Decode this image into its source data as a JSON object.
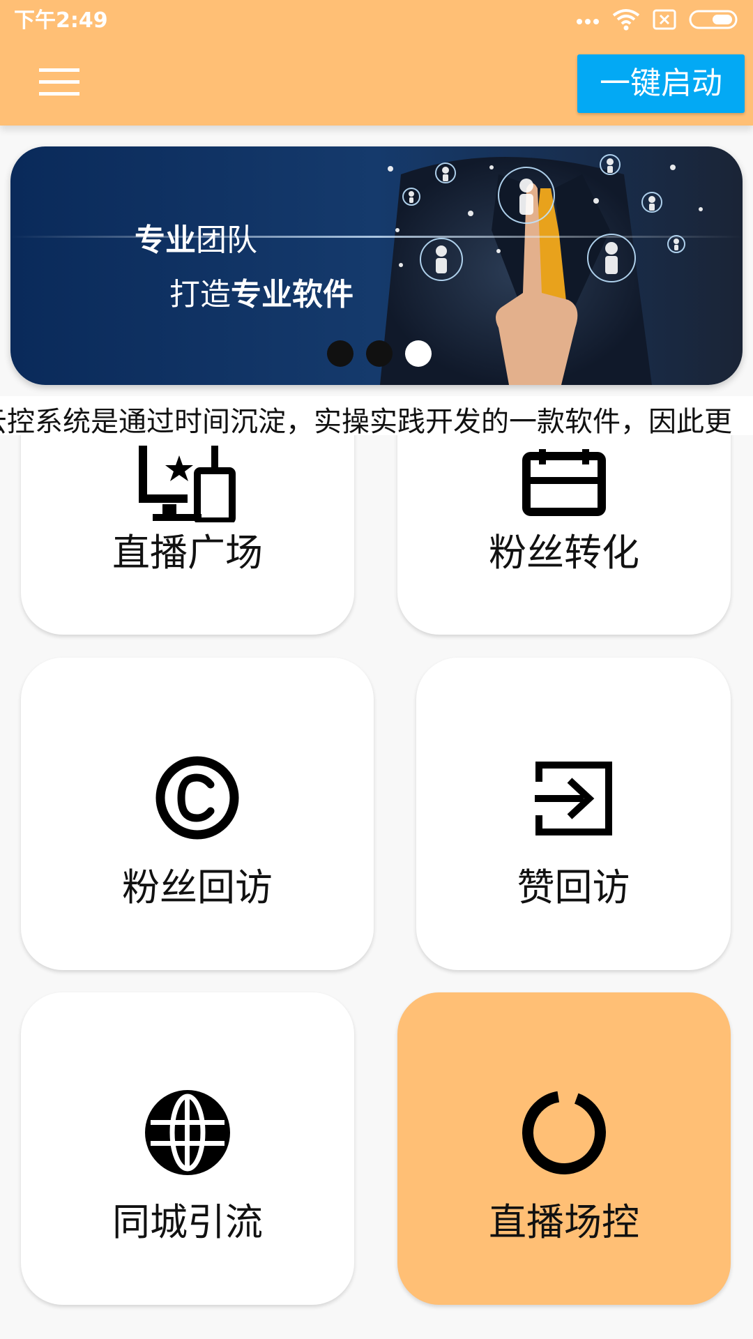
{
  "status_bar": {
    "time": "下午2:49",
    "icons": [
      "more-dots-icon",
      "wifi-icon",
      "no-sim-icon",
      "battery-icon"
    ]
  },
  "app_bar": {
    "menu_icon": "hamburger-menu-icon",
    "start_button_label": "一键启动",
    "background_color": "#ffbf75",
    "button_color": "#03a9f4"
  },
  "banner": {
    "line1_bold": "专业",
    "line1_rest": "团队",
    "line2_prefix": "打造",
    "line2_bold": "专业软件",
    "active_page": 3,
    "page_count": 3
  },
  "marquee": {
    "text": "云控系统是通过时间沉淀，实操实践开发的一款软件，因此更"
  },
  "grid": {
    "items": [
      {
        "label": "直播广场",
        "icon": "live-broadcast-icon"
      },
      {
        "label": "粉丝转化",
        "icon": "calendar-icon"
      },
      {
        "label": "粉丝回访",
        "icon": "copyright-icon"
      },
      {
        "label": "赞回访",
        "icon": "exit-to-app-icon"
      },
      {
        "label": "同城引流",
        "icon": "globe-icon"
      },
      {
        "label": "直播场控",
        "icon": "donut-chart-icon",
        "selected": true
      }
    ],
    "selected_color": "#ffbf75"
  }
}
